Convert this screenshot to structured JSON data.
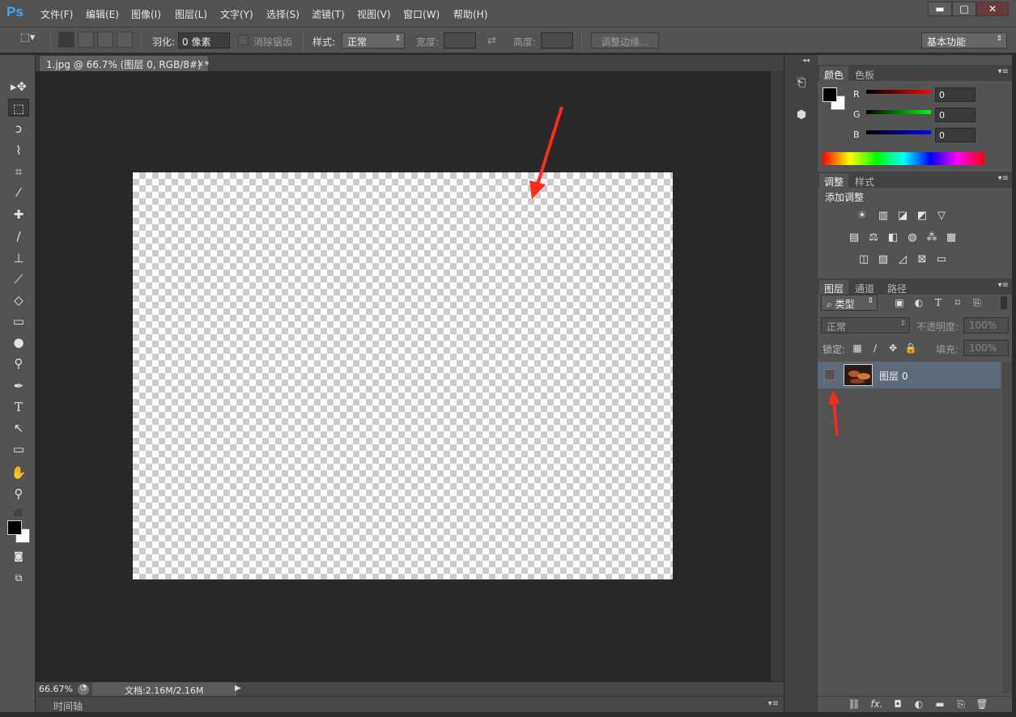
{
  "app": {
    "logo": "Ps"
  },
  "menu": [
    "文件(F)",
    "编辑(E)",
    "图像(I)",
    "图层(L)",
    "文字(Y)",
    "选择(S)",
    "滤镜(T)",
    "视图(V)",
    "窗口(W)",
    "帮助(H)"
  ],
  "window_controls": {
    "minimize": "▬",
    "maximize": "□",
    "close": "✕"
  },
  "options": {
    "feather_label": "羽化:",
    "feather_value": "0 像素",
    "antialias_label": "消除锯齿",
    "style_label": "样式:",
    "style_value": "正常",
    "width_label": "宽度:",
    "height_label": "高度:",
    "refine_edge": "调整边缘...",
    "workspace": "基本功能"
  },
  "document": {
    "tab_title": "1.jpg @ 66.7% (图层 0, RGB/8#) *",
    "close": "×"
  },
  "status": {
    "zoom": "66.67%",
    "doc_info": "文档:2.16M/2.16M",
    "timeline": "时间轴"
  },
  "color_panel": {
    "tabs": [
      "颜色",
      "色板"
    ],
    "r_label": "R",
    "g_label": "G",
    "b_label": "B",
    "r_value": "0",
    "g_value": "0",
    "b_value": "0",
    "fg_color": "#000000",
    "bg_color": "#ffffff"
  },
  "adjust_panel": {
    "tabs": [
      "调整",
      "样式"
    ],
    "title": "添加调整"
  },
  "layers_panel": {
    "tabs": [
      "图层",
      "通道",
      "路径"
    ],
    "filter_kind": "类型",
    "blend_mode": "正常",
    "opacity_label": "不透明度:",
    "opacity_value": "100%",
    "lock_label": "锁定:",
    "fill_label": "填充:",
    "fill_value": "100%",
    "layers": [
      {
        "name": "图层 0"
      }
    ],
    "footer_fx": "fx."
  },
  "colors": {
    "arrow": "#ff2a1a",
    "selected_layer": "#5d6a7a"
  }
}
